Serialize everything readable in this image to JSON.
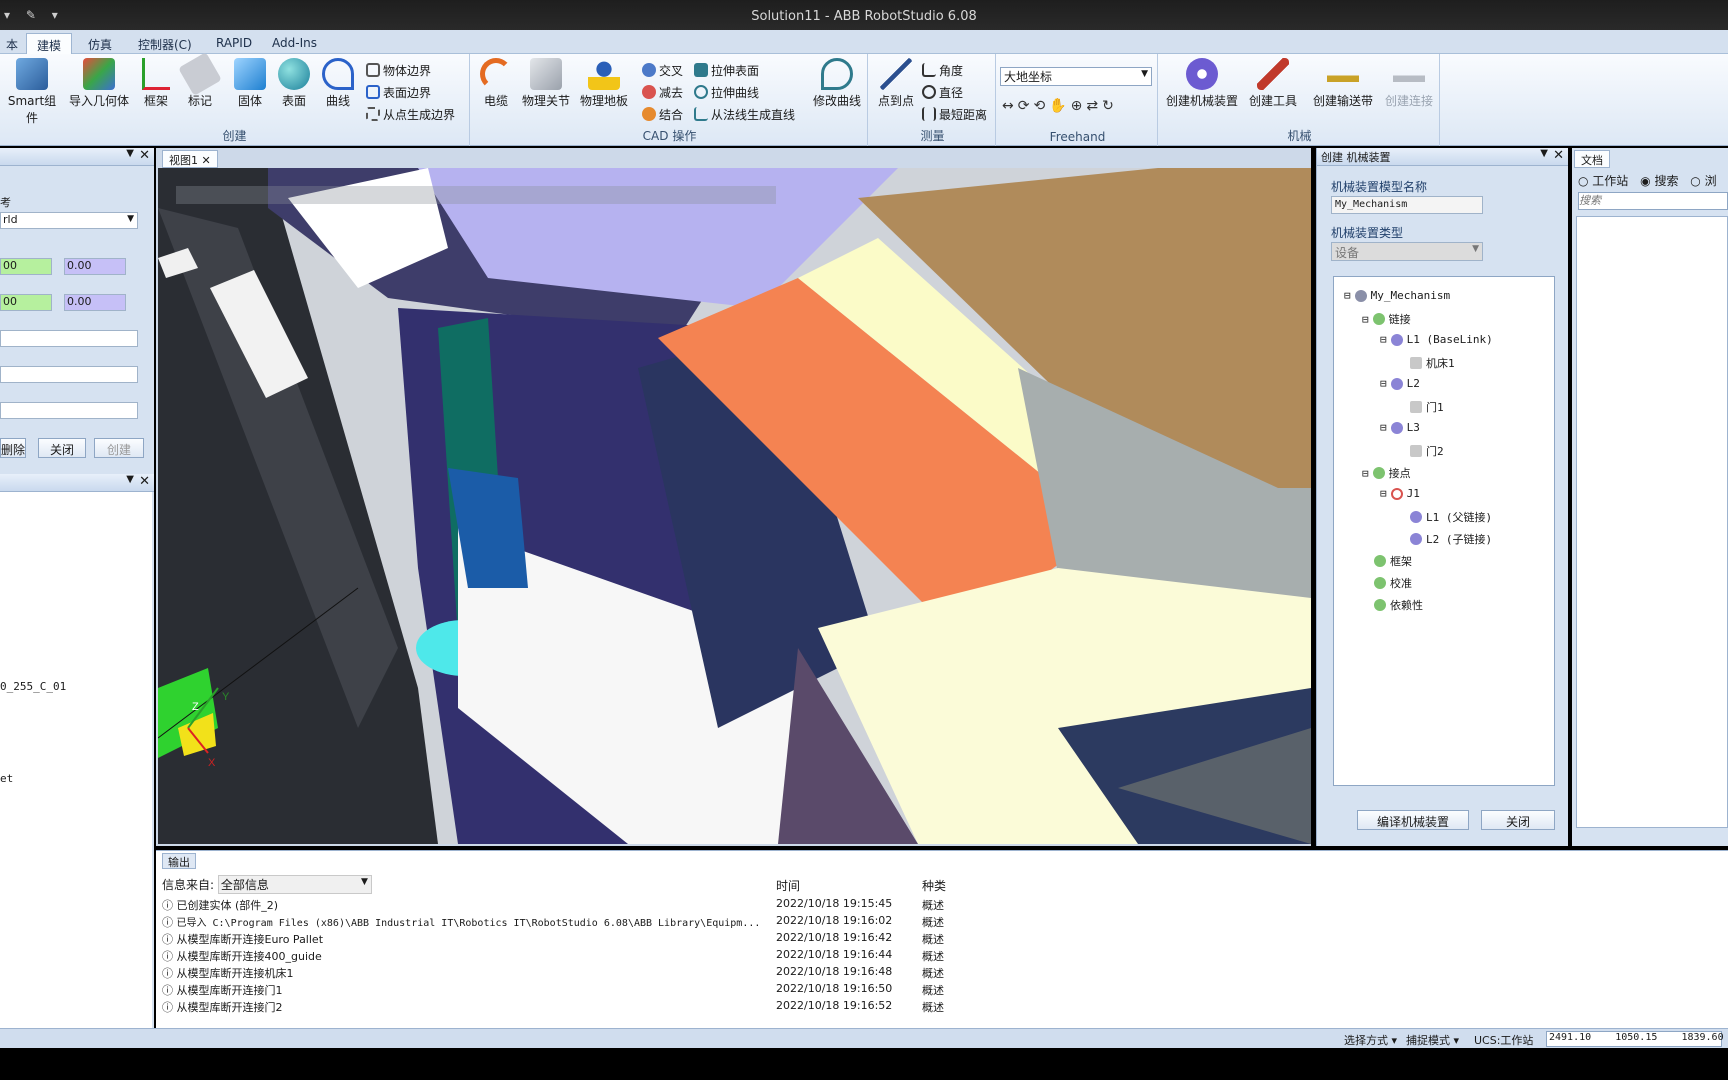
{
  "window": {
    "title": "Solution11 - ABB RobotStudio 6.08",
    "qat": "▾ ✎ ▾"
  },
  "menu": {
    "tabs": [
      {
        "label": "本"
      },
      {
        "label": "建模"
      },
      {
        "label": "仿真"
      },
      {
        "label": "控制器(C)"
      },
      {
        "label": "RAPID"
      },
      {
        "label": "Add-Ins"
      }
    ]
  },
  "ribbon": {
    "create": {
      "label": "创建",
      "smart": "Smart组件",
      "import": "导入几何体",
      "frame": "框架",
      "tag": "标记",
      "solid": "固体",
      "surface": "表面",
      "curve": "曲线",
      "edge_body": "物体边界",
      "edge_surface": "表面边界",
      "edge_points": "从点生成边界"
    },
    "cad": {
      "label": "CAD 操作",
      "cable": "电缆",
      "phys_joint": "物理关节",
      "phys_floor": "物理地板",
      "intersect": "交叉",
      "subtract": "减去",
      "union": "结合",
      "extrude_surface": "拉伸表面",
      "extrude_curve": "拉伸曲线",
      "line_from_normal": "从法线生成直线",
      "modify_curve": "修改曲线"
    },
    "measure": {
      "label": "测量",
      "p2p": "点到点",
      "angle": "角度",
      "diameter": "直径",
      "min_dist": "最短距离"
    },
    "freehand": {
      "label": "Freehand",
      "coord": "大地坐标"
    },
    "mechanism": {
      "label": "机械",
      "create_mech": "创建机械装置",
      "create_tool": "创建工具",
      "create_conveyor": "创建输送带",
      "create_connection": "创建连接"
    }
  },
  "left": {
    "ref_label": "考",
    "ref_value": "rld",
    "f1a": "00",
    "f1b": "0.00",
    "f2a": "00",
    "f2b": "0.00",
    "btn_remove": "删除",
    "btn_close": "关闭",
    "btn_create": "创建",
    "item1": "0_255_C_01",
    "item2": "et"
  },
  "viewport": {
    "tab": "视图1"
  },
  "mechanism_panel": {
    "title": "创建 机械装置",
    "name_label": "机械装置模型名称",
    "name_value": "My_Mechanism",
    "type_label": "机械装置类型",
    "type_value": "设备",
    "tree": {
      "root": "My_Mechanism",
      "links": "链接",
      "l1": "L1 (BaseLink)",
      "l1c": "机床1",
      "l2": "L2",
      "l2c": "门1",
      "l3": "L3",
      "l3c": "门2",
      "joints": "接点",
      "j1": "J1",
      "j1p": "L1 (父链接)",
      "j1c": "L2 (子链接)",
      "frames": "框架",
      "calib": "校准",
      "deps": "依赖性"
    },
    "compile_btn": "编译机械装置",
    "close_btn": "关闭"
  },
  "doc_panel": {
    "title": "文档",
    "opt_station": "工作站",
    "opt_search": "搜索",
    "opt_browse": "浏",
    "search_placeholder": "搜索"
  },
  "output": {
    "tab": "输出",
    "filter_label": "信息来自:",
    "filter_value": "全部信息",
    "col_time": "时间",
    "col_type": "种类",
    "rows": [
      {
        "msg": "已创建实体 (部件_2)",
        "time": "2022/10/18 19:15:45",
        "type": "概述"
      },
      {
        "msg": "已导入 C:\\Program Files (x86)\\ABB Industrial IT\\Robotics IT\\RobotStudio 6.08\\ABB Library\\Equipm...",
        "time": "2022/10/18 19:16:02",
        "type": "概述"
      },
      {
        "msg": "从模型库断开连接Euro Pallet",
        "time": "2022/10/18 19:16:42",
        "type": "概述"
      },
      {
        "msg": "从模型库断开连接400_guide",
        "time": "2022/10/18 19:16:44",
        "type": "概述"
      },
      {
        "msg": "从模型库断开连接机床1",
        "time": "2022/10/18 19:16:48",
        "type": "概述"
      },
      {
        "msg": "从模型库断开连接门1",
        "time": "2022/10/18 19:16:50",
        "type": "概述"
      },
      {
        "msg": "从模型库断开连接门2",
        "time": "2022/10/18 19:16:52",
        "type": "概述"
      }
    ]
  },
  "status": {
    "select_mode": "选择方式",
    "snap_mode": "捕捉模式",
    "ucs": "UCS:工作站",
    "coords": "2491.10    1050.15    1839.60"
  }
}
